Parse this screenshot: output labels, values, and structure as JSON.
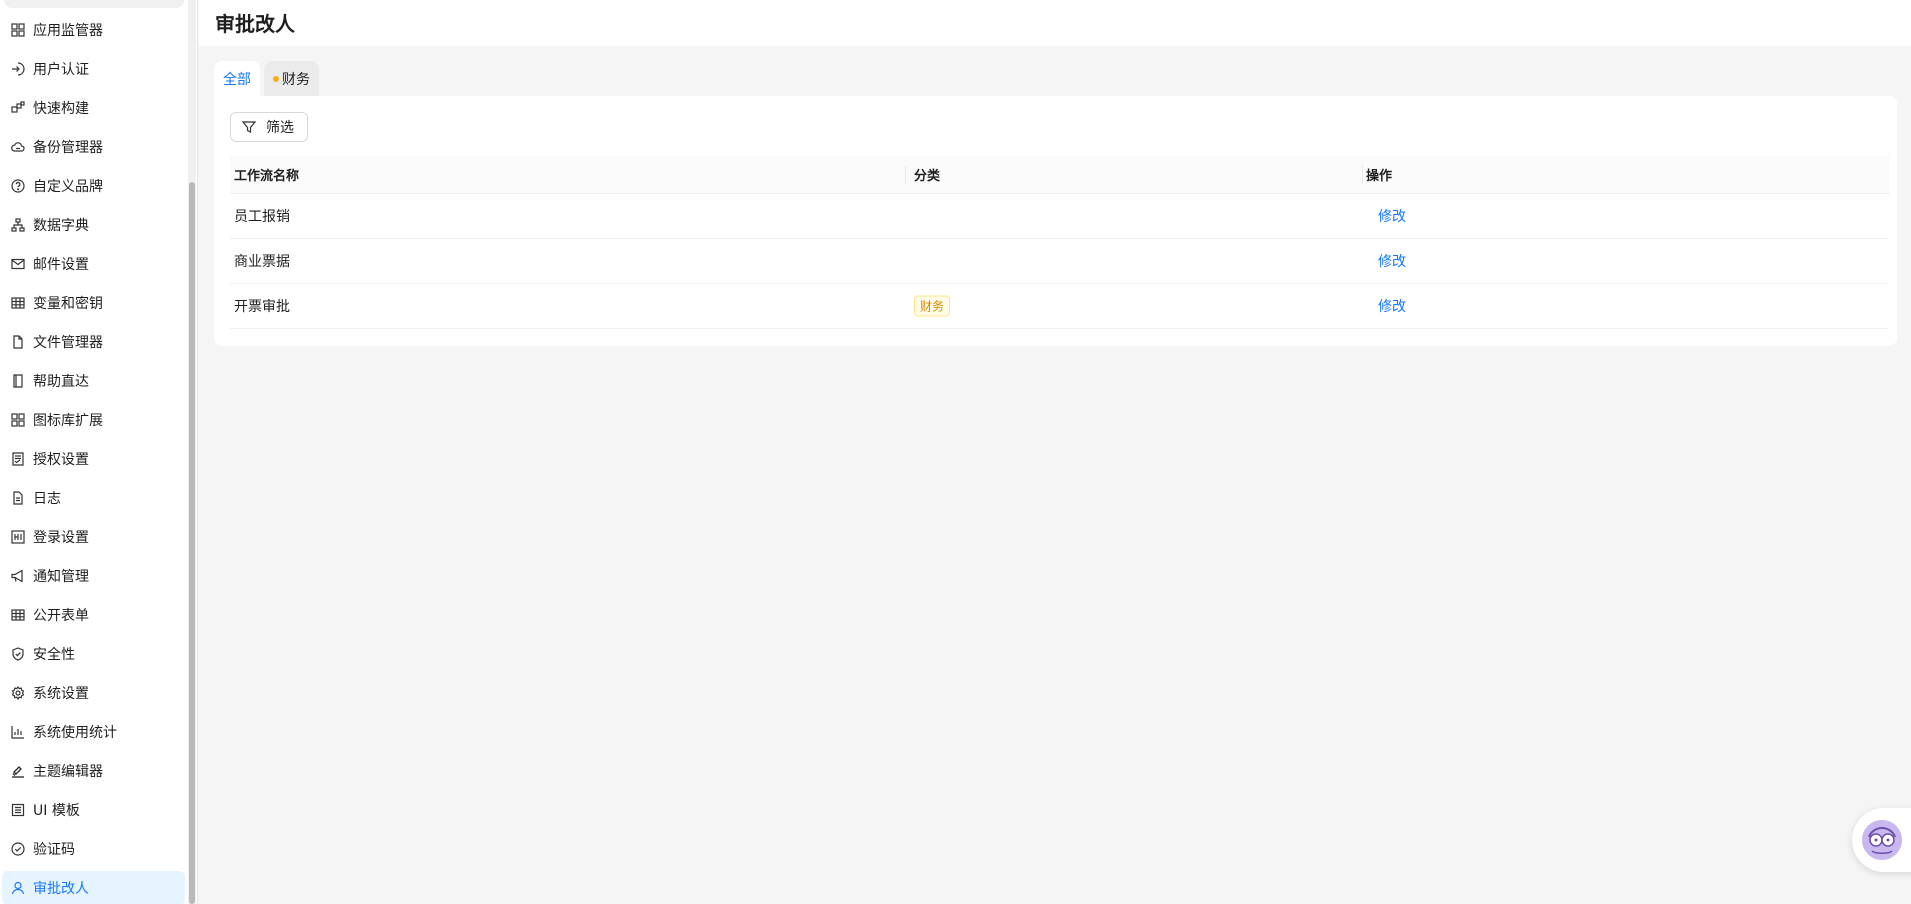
{
  "page": {
    "title": "审批改人"
  },
  "sidebar": {
    "items": [
      {
        "label": "应用监管器",
        "icon": "grid-icon"
      },
      {
        "label": "用户认证",
        "icon": "login-icon"
      },
      {
        "label": "快速构建",
        "icon": "blocks-icon"
      },
      {
        "label": "备份管理器",
        "icon": "cloud-icon"
      },
      {
        "label": "自定义品牌",
        "icon": "question-circle-icon"
      },
      {
        "label": "数据字典",
        "icon": "hierarchy-icon"
      },
      {
        "label": "邮件设置",
        "icon": "mail-icon"
      },
      {
        "label": "变量和密钥",
        "icon": "table-icon"
      },
      {
        "label": "文件管理器",
        "icon": "file-icon"
      },
      {
        "label": "帮助直达",
        "icon": "book-icon"
      },
      {
        "label": "图标库扩展",
        "icon": "apps-icon"
      },
      {
        "label": "授权设置",
        "icon": "document-check-icon"
      },
      {
        "label": "日志",
        "icon": "file-text-icon"
      },
      {
        "label": "登录设置",
        "icon": "login-settings-icon"
      },
      {
        "label": "通知管理",
        "icon": "megaphone-icon"
      },
      {
        "label": "公开表单",
        "icon": "table-icon"
      },
      {
        "label": "安全性",
        "icon": "shield-icon"
      },
      {
        "label": "系统设置",
        "icon": "gear-icon"
      },
      {
        "label": "系统使用统计",
        "icon": "bar-chart-icon"
      },
      {
        "label": "主题编辑器",
        "icon": "brush-icon"
      },
      {
        "label": "UI 模板",
        "icon": "list-box-icon"
      },
      {
        "label": "验证码",
        "icon": "check-circle-icon"
      },
      {
        "label": "审批改人",
        "icon": "user-icon",
        "active": true
      }
    ]
  },
  "tabs": [
    {
      "label": "全部",
      "active": true
    },
    {
      "label": "财务",
      "dot_color": "#faad14"
    }
  ],
  "toolbar": {
    "filter_label": "筛选"
  },
  "table": {
    "columns": [
      "工作流名称",
      "分类",
      "操作"
    ],
    "rows": [
      {
        "name": "员工报销",
        "category": "",
        "action": "修改"
      },
      {
        "name": "商业票据",
        "category": "",
        "action": "修改"
      },
      {
        "name": "开票审批",
        "category": "财务",
        "action": "修改"
      }
    ]
  },
  "colors": {
    "accent": "#1677ff",
    "active_bg": "#e6f4ff",
    "tag_text": "#d48806",
    "tag_bg": "#fffbe6",
    "tag_border": "#ffe58f"
  }
}
